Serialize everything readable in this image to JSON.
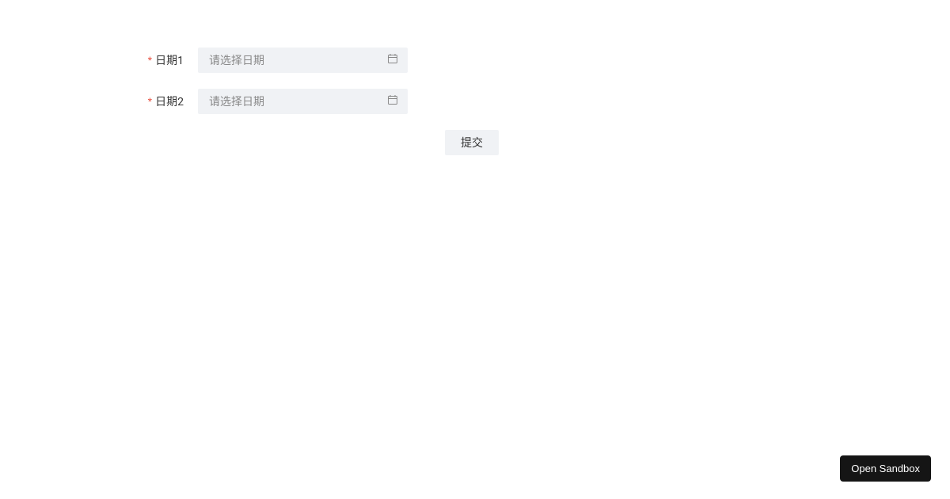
{
  "form": {
    "fields": [
      {
        "label": "日期1",
        "placeholder": "请选择日期",
        "required": true
      },
      {
        "label": "日期2",
        "placeholder": "请选择日期",
        "required": true
      }
    ],
    "submit_label": "提交"
  },
  "sandbox": {
    "label": "Open Sandbox"
  }
}
